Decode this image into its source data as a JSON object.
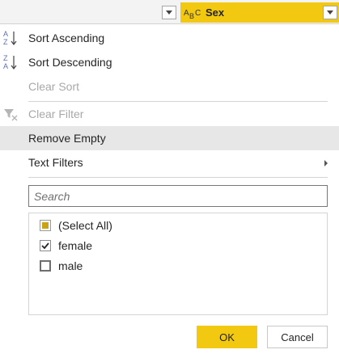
{
  "header": {
    "column_name": "Sex",
    "column_type_icon": "text-type-icon",
    "accent_color": "#f2c811"
  },
  "menu": {
    "sort_ascending": "Sort Ascending",
    "sort_descending": "Sort Descending",
    "clear_sort": "Clear Sort",
    "clear_filter": "Clear Filter",
    "remove_empty": "Remove Empty",
    "text_filters": "Text Filters"
  },
  "search": {
    "placeholder": "Search",
    "value": ""
  },
  "values_list": {
    "items": [
      {
        "label": "(Select All)",
        "state": "partial"
      },
      {
        "label": "female",
        "state": "checked"
      },
      {
        "label": "male",
        "state": "unchecked"
      }
    ]
  },
  "buttons": {
    "ok": "OK",
    "cancel": "Cancel"
  }
}
